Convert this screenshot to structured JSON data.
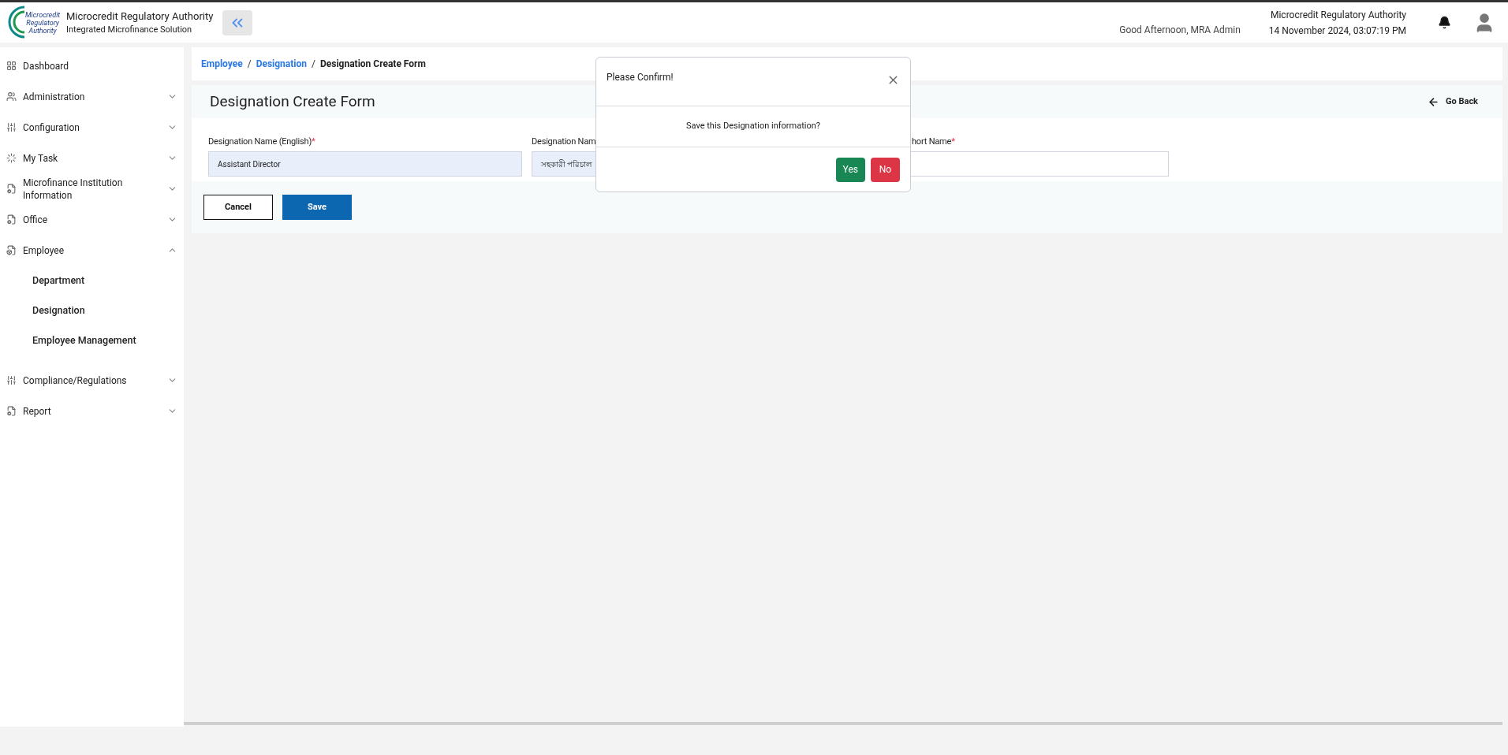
{
  "header": {
    "logo_text": [
      "Microcredit",
      "Regulatory",
      "Authority"
    ],
    "title": "Microcredit Regulatory Authority",
    "subtitle": "Integrated Microfinance Solution",
    "greeting": "Good Afternoon, MRA Admin",
    "org": "Microcredit Regulatory Authority",
    "datetime": "14 November 2024, 03:07:19 PM"
  },
  "sidebar": {
    "items": [
      {
        "label": "Dashboard"
      },
      {
        "label": "Administration",
        "expanded": false
      },
      {
        "label": "Configuration",
        "expanded": false
      },
      {
        "label": "My Task",
        "expanded": false
      },
      {
        "label": "Microfinance Institution Information",
        "expanded": false
      },
      {
        "label": "Office",
        "expanded": false
      },
      {
        "label": "Employee",
        "expanded": true,
        "children": [
          {
            "label": "Department"
          },
          {
            "label": "Designation"
          },
          {
            "label": "Employee Management"
          }
        ]
      },
      {
        "label": "Compliance/Regulations",
        "expanded": false
      },
      {
        "label": "Report",
        "expanded": false
      }
    ]
  },
  "breadcrumb": [
    {
      "label": "Employee",
      "kind": "link"
    },
    {
      "label": "/",
      "kind": "separator"
    },
    {
      "label": "Designation",
      "kind": "link"
    },
    {
      "label": "/",
      "kind": "separator"
    },
    {
      "label": "Designation Create Form",
      "kind": "current"
    }
  ],
  "form": {
    "title": "Designation Create Form",
    "go_back": "Go Back",
    "fields": [
      {
        "label": "Designation Name (English)",
        "required_mark": "*",
        "value": "Assistant Director",
        "filled": true
      },
      {
        "label": "Designation Nam",
        "value": "সহকারী পরিচাল",
        "filled": true
      },
      {
        "label": "hort Name",
        "required_mark": "*",
        "filled": false
      }
    ],
    "buttons": [
      {
        "label": "Cancel",
        "kind": "outline"
      },
      {
        "label": "Save",
        "kind": "primary"
      }
    ]
  },
  "dialog": {
    "title": "Please Confirm!",
    "message": "Save this Designation information?",
    "buttons": [
      {
        "label": "Yes",
        "kind": "success"
      },
      {
        "label": "No",
        "kind": "danger"
      }
    ]
  }
}
